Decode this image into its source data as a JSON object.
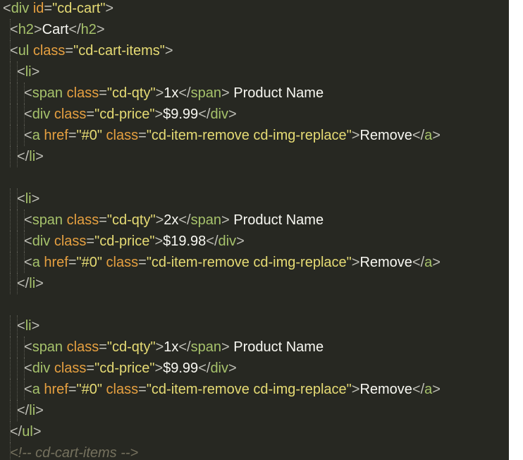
{
  "editor": {
    "colors": {
      "background": "#272822",
      "punct": "#c0c0b8",
      "tagname": "#a6c26b",
      "attr": "#e6a040",
      "string": "#e6db74",
      "text": "#f8f8f2",
      "comment": "#75715e"
    },
    "lines": [
      {
        "indent": 0,
        "tokens": [
          {
            "t": "<",
            "c": "punct"
          },
          {
            "t": "div",
            "c": "tagname"
          },
          {
            "t": " ",
            "c": "text"
          },
          {
            "t": "id",
            "c": "attr"
          },
          {
            "t": "=",
            "c": "punct"
          },
          {
            "t": "\"cd-cart\"",
            "c": "str"
          },
          {
            "t": ">",
            "c": "punct"
          }
        ]
      },
      {
        "indent": 1,
        "tokens": [
          {
            "t": "<",
            "c": "punct"
          },
          {
            "t": "h2",
            "c": "tagname"
          },
          {
            "t": ">",
            "c": "punct"
          },
          {
            "t": "Cart",
            "c": "text"
          },
          {
            "t": "</",
            "c": "punct"
          },
          {
            "t": "h2",
            "c": "tagname"
          },
          {
            "t": ">",
            "c": "punct"
          }
        ]
      },
      {
        "indent": 1,
        "tokens": [
          {
            "t": "<",
            "c": "punct"
          },
          {
            "t": "ul",
            "c": "tagname"
          },
          {
            "t": " ",
            "c": "text"
          },
          {
            "t": "class",
            "c": "attr"
          },
          {
            "t": "=",
            "c": "punct"
          },
          {
            "t": "\"cd-cart-items\"",
            "c": "str"
          },
          {
            "t": ">",
            "c": "punct"
          }
        ]
      },
      {
        "indent": 2,
        "tokens": [
          {
            "t": "<",
            "c": "punct"
          },
          {
            "t": "li",
            "c": "tagname"
          },
          {
            "t": ">",
            "c": "punct"
          }
        ]
      },
      {
        "indent": 3,
        "tokens": [
          {
            "t": "<",
            "c": "punct"
          },
          {
            "t": "span",
            "c": "tagname"
          },
          {
            "t": " ",
            "c": "text"
          },
          {
            "t": "class",
            "c": "attr"
          },
          {
            "t": "=",
            "c": "punct"
          },
          {
            "t": "\"cd-qty\"",
            "c": "str"
          },
          {
            "t": ">",
            "c": "punct"
          },
          {
            "t": "1x",
            "c": "text"
          },
          {
            "t": "</",
            "c": "punct"
          },
          {
            "t": "span",
            "c": "tagname"
          },
          {
            "t": ">",
            "c": "punct"
          },
          {
            "t": " Product Name",
            "c": "text"
          }
        ]
      },
      {
        "indent": 3,
        "tokens": [
          {
            "t": "<",
            "c": "punct"
          },
          {
            "t": "div",
            "c": "tagname"
          },
          {
            "t": " ",
            "c": "text"
          },
          {
            "t": "class",
            "c": "attr"
          },
          {
            "t": "=",
            "c": "punct"
          },
          {
            "t": "\"cd-price\"",
            "c": "str"
          },
          {
            "t": ">",
            "c": "punct"
          },
          {
            "t": "$9.99",
            "c": "text"
          },
          {
            "t": "</",
            "c": "punct"
          },
          {
            "t": "div",
            "c": "tagname"
          },
          {
            "t": ">",
            "c": "punct"
          }
        ]
      },
      {
        "indent": 3,
        "tokens": [
          {
            "t": "<",
            "c": "punct"
          },
          {
            "t": "a",
            "c": "tagname"
          },
          {
            "t": " ",
            "c": "text"
          },
          {
            "t": "href",
            "c": "attr"
          },
          {
            "t": "=",
            "c": "punct"
          },
          {
            "t": "\"#0\"",
            "c": "str"
          },
          {
            "t": " ",
            "c": "text"
          },
          {
            "t": "class",
            "c": "attr"
          },
          {
            "t": "=",
            "c": "punct"
          },
          {
            "t": "\"cd-item-remove cd-img-replace\"",
            "c": "str"
          },
          {
            "t": ">",
            "c": "punct"
          },
          {
            "t": "Remove",
            "c": "text"
          },
          {
            "t": "</",
            "c": "punct"
          },
          {
            "t": "a",
            "c": "tagname"
          },
          {
            "t": ">",
            "c": "punct"
          }
        ]
      },
      {
        "indent": 2,
        "tokens": [
          {
            "t": "</",
            "c": "punct"
          },
          {
            "t": "li",
            "c": "tagname"
          },
          {
            "t": ">",
            "c": "punct"
          }
        ]
      },
      {
        "indent": 0,
        "tokens": []
      },
      {
        "indent": 2,
        "tokens": [
          {
            "t": "<",
            "c": "punct"
          },
          {
            "t": "li",
            "c": "tagname"
          },
          {
            "t": ">",
            "c": "punct"
          }
        ]
      },
      {
        "indent": 3,
        "tokens": [
          {
            "t": "<",
            "c": "punct"
          },
          {
            "t": "span",
            "c": "tagname"
          },
          {
            "t": " ",
            "c": "text"
          },
          {
            "t": "class",
            "c": "attr"
          },
          {
            "t": "=",
            "c": "punct"
          },
          {
            "t": "\"cd-qty\"",
            "c": "str"
          },
          {
            "t": ">",
            "c": "punct"
          },
          {
            "t": "2x",
            "c": "text"
          },
          {
            "t": "</",
            "c": "punct"
          },
          {
            "t": "span",
            "c": "tagname"
          },
          {
            "t": ">",
            "c": "punct"
          },
          {
            "t": " Product Name",
            "c": "text"
          }
        ]
      },
      {
        "indent": 3,
        "tokens": [
          {
            "t": "<",
            "c": "punct"
          },
          {
            "t": "div",
            "c": "tagname"
          },
          {
            "t": " ",
            "c": "text"
          },
          {
            "t": "class",
            "c": "attr"
          },
          {
            "t": "=",
            "c": "punct"
          },
          {
            "t": "\"cd-price\"",
            "c": "str"
          },
          {
            "t": ">",
            "c": "punct"
          },
          {
            "t": "$19.98",
            "c": "text"
          },
          {
            "t": "</",
            "c": "punct"
          },
          {
            "t": "div",
            "c": "tagname"
          },
          {
            "t": ">",
            "c": "punct"
          }
        ]
      },
      {
        "indent": 3,
        "tokens": [
          {
            "t": "<",
            "c": "punct"
          },
          {
            "t": "a",
            "c": "tagname"
          },
          {
            "t": " ",
            "c": "text"
          },
          {
            "t": "href",
            "c": "attr"
          },
          {
            "t": "=",
            "c": "punct"
          },
          {
            "t": "\"#0\"",
            "c": "str"
          },
          {
            "t": " ",
            "c": "text"
          },
          {
            "t": "class",
            "c": "attr"
          },
          {
            "t": "=",
            "c": "punct"
          },
          {
            "t": "\"cd-item-remove cd-img-replace\"",
            "c": "str"
          },
          {
            "t": ">",
            "c": "punct"
          },
          {
            "t": "Remove",
            "c": "text"
          },
          {
            "t": "</",
            "c": "punct"
          },
          {
            "t": "a",
            "c": "tagname"
          },
          {
            "t": ">",
            "c": "punct"
          }
        ]
      },
      {
        "indent": 2,
        "tokens": [
          {
            "t": "</",
            "c": "punct"
          },
          {
            "t": "li",
            "c": "tagname"
          },
          {
            "t": ">",
            "c": "punct"
          }
        ]
      },
      {
        "indent": 0,
        "tokens": []
      },
      {
        "indent": 2,
        "tokens": [
          {
            "t": "<",
            "c": "punct"
          },
          {
            "t": "li",
            "c": "tagname"
          },
          {
            "t": ">",
            "c": "punct"
          }
        ]
      },
      {
        "indent": 3,
        "tokens": [
          {
            "t": "<",
            "c": "punct"
          },
          {
            "t": "span",
            "c": "tagname"
          },
          {
            "t": " ",
            "c": "text"
          },
          {
            "t": "class",
            "c": "attr"
          },
          {
            "t": "=",
            "c": "punct"
          },
          {
            "t": "\"cd-qty\"",
            "c": "str"
          },
          {
            "t": ">",
            "c": "punct"
          },
          {
            "t": "1x",
            "c": "text"
          },
          {
            "t": "</",
            "c": "punct"
          },
          {
            "t": "span",
            "c": "tagname"
          },
          {
            "t": ">",
            "c": "punct"
          },
          {
            "t": " Product Name",
            "c": "text"
          }
        ]
      },
      {
        "indent": 3,
        "tokens": [
          {
            "t": "<",
            "c": "punct"
          },
          {
            "t": "div",
            "c": "tagname"
          },
          {
            "t": " ",
            "c": "text"
          },
          {
            "t": "class",
            "c": "attr"
          },
          {
            "t": "=",
            "c": "punct"
          },
          {
            "t": "\"cd-price\"",
            "c": "str"
          },
          {
            "t": ">",
            "c": "punct"
          },
          {
            "t": "$9.99",
            "c": "text"
          },
          {
            "t": "</",
            "c": "punct"
          },
          {
            "t": "div",
            "c": "tagname"
          },
          {
            "t": ">",
            "c": "punct"
          }
        ]
      },
      {
        "indent": 3,
        "tokens": [
          {
            "t": "<",
            "c": "punct"
          },
          {
            "t": "a",
            "c": "tagname"
          },
          {
            "t": " ",
            "c": "text"
          },
          {
            "t": "href",
            "c": "attr"
          },
          {
            "t": "=",
            "c": "punct"
          },
          {
            "t": "\"#0\"",
            "c": "str"
          },
          {
            "t": " ",
            "c": "text"
          },
          {
            "t": "class",
            "c": "attr"
          },
          {
            "t": "=",
            "c": "punct"
          },
          {
            "t": "\"cd-item-remove cd-img-replace\"",
            "c": "str"
          },
          {
            "t": ">",
            "c": "punct"
          },
          {
            "t": "Remove",
            "c": "text"
          },
          {
            "t": "</",
            "c": "punct"
          },
          {
            "t": "a",
            "c": "tagname"
          },
          {
            "t": ">",
            "c": "punct"
          }
        ]
      },
      {
        "indent": 2,
        "tokens": [
          {
            "t": "</",
            "c": "punct"
          },
          {
            "t": "li",
            "c": "tagname"
          },
          {
            "t": ">",
            "c": "punct"
          }
        ]
      },
      {
        "indent": 1,
        "tokens": [
          {
            "t": "</",
            "c": "punct"
          },
          {
            "t": "ul",
            "c": "tagname"
          },
          {
            "t": ">",
            "c": "punct"
          }
        ]
      },
      {
        "indent": 1,
        "tokens": [
          {
            "t": "<!-- cd-cart-items -->",
            "c": "comment"
          }
        ]
      }
    ]
  }
}
